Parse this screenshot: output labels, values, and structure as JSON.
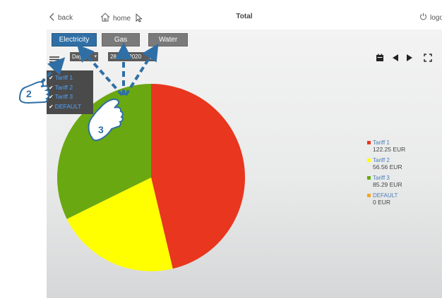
{
  "topbar": {
    "back_label": "back",
    "home_label": "home",
    "title": "Total",
    "logout_label": "logo"
  },
  "tabs": [
    {
      "label": "Electricity",
      "active": true
    },
    {
      "label": "Gas",
      "active": false
    },
    {
      "label": "Water",
      "active": false
    }
  ],
  "controls": {
    "period_value": "Day",
    "date_value": "28 Jan 2020"
  },
  "tariff_menu": {
    "items": [
      {
        "label": "Tariff 1",
        "checked": true
      },
      {
        "label": "Tariff 2",
        "checked": true
      },
      {
        "label": "Tariff 3",
        "checked": true
      },
      {
        "label": "DEFAULT",
        "checked": true
      }
    ]
  },
  "callouts": {
    "step_2": "2",
    "step_3": "3"
  },
  "colors": {
    "tariff1": "#e8371e",
    "tariff2": "#ffff00",
    "tariff3": "#6aa811",
    "default": "#f5a623",
    "tab_active": "#2f6fa5",
    "arrow": "#2f6fa5"
  },
  "chart_data": {
    "type": "pie",
    "title": "",
    "categories": [
      "Tariff 1",
      "Tariff 2",
      "Tariff 3",
      "DEFAULT"
    ],
    "values": [
      122.25,
      56.56,
      85.29,
      0
    ],
    "unit": "EUR",
    "legend": [
      {
        "name": "Tariff 1",
        "value": "122.25 EUR",
        "color": "#e8371e"
      },
      {
        "name": "Tariff 2",
        "value": "56.56 EUR",
        "color": "#ffff00"
      },
      {
        "name": "Tariff 3",
        "value": "85.29 EUR",
        "color": "#6aa811"
      },
      {
        "name": "DEFAULT",
        "value": "0 EUR",
        "color": "#f5a623"
      }
    ],
    "legend_position": "right"
  }
}
